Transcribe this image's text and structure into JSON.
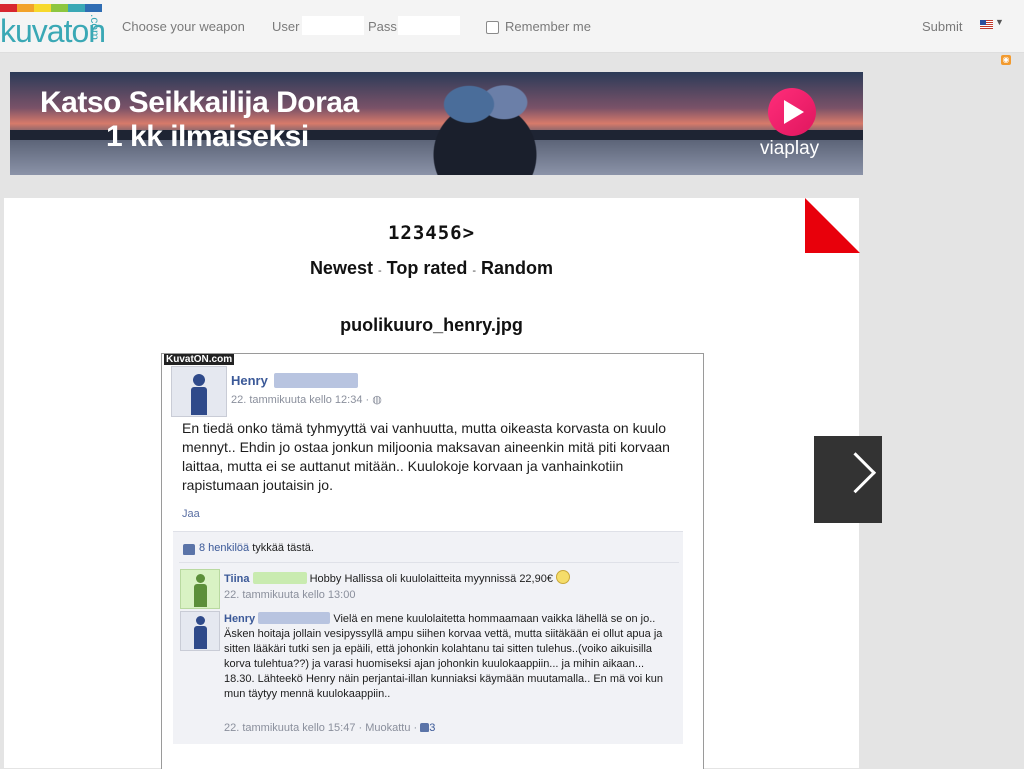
{
  "header": {
    "logo_text": "kuvaton",
    "logo_suffix": ".com",
    "logo_colors": [
      "#d8262f",
      "#f2a22a",
      "#f7d92c",
      "#8dc63f",
      "#3aa8b5",
      "#2f6db3"
    ],
    "choose_weapon": "Choose your weapon",
    "user_label": "User",
    "pass_label": "Pass",
    "remember_label": "Remember me",
    "submit_label": "Submit",
    "language_icon": "us-flag-icon"
  },
  "ad": {
    "line1": "Katso Seikkailija Doraa",
    "line2": "1 kk ilmaiseksi",
    "brand": "viaplay"
  },
  "pager": {
    "pages": "123456>"
  },
  "sort": {
    "newest": "Newest",
    "top_rated": "Top rated",
    "random": "Random",
    "separator": "-"
  },
  "image": {
    "filename": "puolikuuro_henry.jpg",
    "watermark": "KuvatON.com",
    "post": {
      "author": "Henry",
      "meta": "22. tammikuuta kello 12:34 · ",
      "text": "En tiedä onko tämä tyhmyyttä vai vanhuutta, mutta oikeasta korvasta on kuulo mennyt.. Ehdin jo ostaa jonkun miljoonia maksavan aineenkin mitä piti korvaan laittaa, mutta ei se auttanut mitään.. Kuulokoje korvaan ja vanhainkotiin rapistumaan joutaisin jo.",
      "share": "Jaa",
      "likes_count": "8 henkilöä",
      "likes_rest": "tykkää tästä."
    },
    "comments": [
      {
        "author": "Tiina",
        "text": "Hobby Hallissa oli kuulolaitteita myynnissä 22,90€",
        "meta": "22. tammikuuta kello 13:00"
      },
      {
        "author": "Henry",
        "text": "Vielä en mene kuulolaitetta hommaamaan vaikka lähellä se on jo.. Äsken hoitaja jollain vesipyssyllä ampu siihen korvaa vettä, mutta siitäkään ei ollut apua ja sitten lääkäri tutki sen ja epäili, että johonkin kolahtanu tai sitten tulehus..(voiko aikuisilla korva tulehtua??) ja varasi huomiseksi ajan johonkin kuulokaappiin... ja mihin aikaan... 18.30. Lähteekö Henry näin perjantai-illan kunniaksi käymään muutamalla.. En mä voi kun mun täytyy mennä kuulokaappiin..",
        "meta": "22. tammikuuta kello 15:47 · Muokattu · ",
        "likes": "3"
      }
    ]
  }
}
